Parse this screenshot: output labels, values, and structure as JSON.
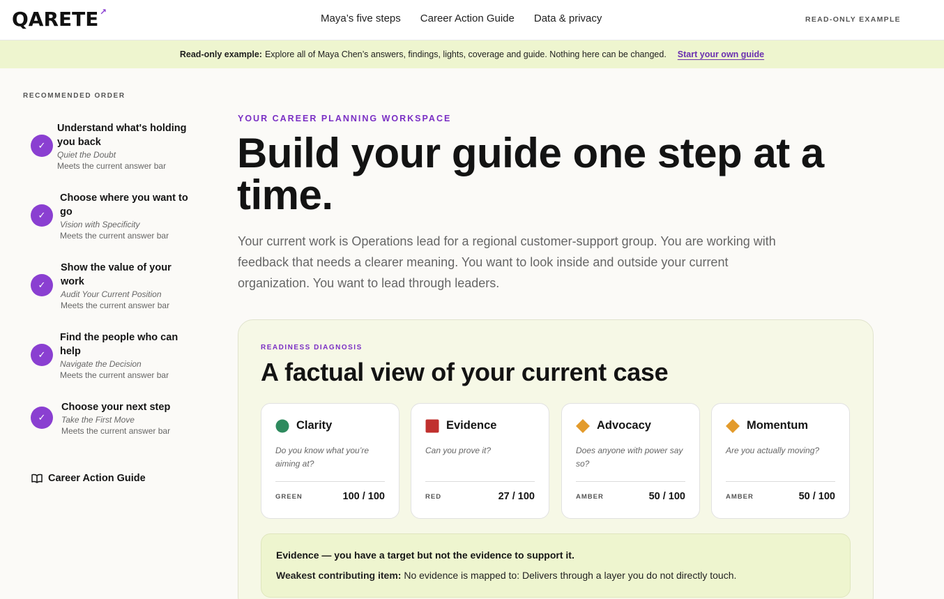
{
  "header": {
    "logo": "QARETE",
    "nav": [
      "Maya’s five steps",
      "Career Action Guide",
      "Data & privacy"
    ],
    "readonly_tag": "READ-ONLY EXAMPLE"
  },
  "banner": {
    "lead": "Read-only example:",
    "text": "Explore all of Maya Chen’s answers, findings, lights, coverage and guide. Nothing here can be changed.",
    "cta": "Start your own guide"
  },
  "sidebar": {
    "heading": "RECOMMENDED ORDER",
    "steps": [
      {
        "title": "Understand what's holding you back",
        "sub": "Quiet the Doubt",
        "meta": "Meets the current answer bar"
      },
      {
        "title": "Choose where you want to go",
        "sub": "Vision with Specificity",
        "meta": "Meets the current answer bar"
      },
      {
        "title": "Show the value of your work",
        "sub": "Audit Your Current Position",
        "meta": "Meets the current answer bar"
      },
      {
        "title": "Find the people who can help",
        "sub": "Navigate the Decision",
        "meta": "Meets the current answer bar"
      },
      {
        "title": "Choose your next step",
        "sub": "Take the First Move",
        "meta": "Meets the current answer bar"
      }
    ],
    "guide_link": "Career Action Guide"
  },
  "main": {
    "eyebrow": "YOUR CAREER PLANNING WORKSPACE",
    "title": "Build your guide one step at a time.",
    "intro": "Your current work is Operations lead for a regional customer-support group. You are working with feedback that needs a clearer meaning. You want to look inside and outside your current organization. You want to lead through leaders."
  },
  "diagnosis": {
    "eyebrow": "READINESS DIAGNOSIS",
    "title": "A factual view of your current case",
    "cards": [
      {
        "name": "Clarity",
        "question": "Do you know what you’re aiming at?",
        "level": "GREEN",
        "score": "100 / 100",
        "shape": "circle",
        "color": "#2e8a5e"
      },
      {
        "name": "Evidence",
        "question": "Can you prove it?",
        "level": "RED",
        "score": "27 / 100",
        "shape": "square",
        "color": "#c0302e"
      },
      {
        "name": "Advocacy",
        "question": "Does anyone with power say so?",
        "level": "AMBER",
        "score": "50 / 100",
        "shape": "diamond",
        "color": "#e39b2c"
      },
      {
        "name": "Momentum",
        "question": "Are you actually moving?",
        "level": "AMBER",
        "score": "50 / 100",
        "shape": "diamond",
        "color": "#e39b2c"
      }
    ],
    "summary_line": "Evidence — you have a target but not the evidence to support it.",
    "weakest_label": "Weakest contributing item:",
    "weakest_text": "No evidence is mapped to: Delivers through a layer you do not directly touch."
  },
  "colors": {
    "accent": "#8a3fd1",
    "banner": "#eef5cf"
  }
}
